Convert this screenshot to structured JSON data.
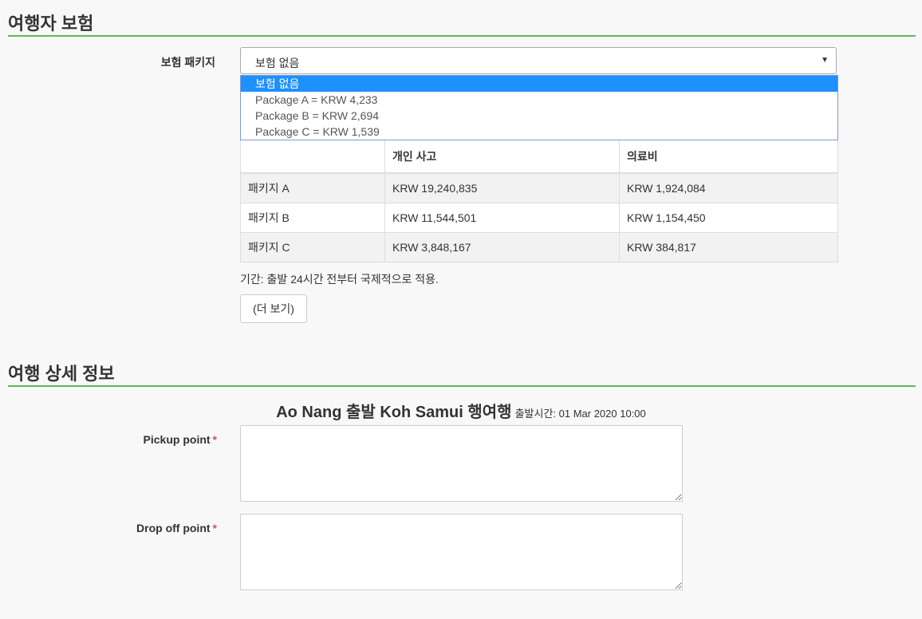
{
  "insurance": {
    "title": "여행자 보험",
    "package_label": "보험 패키지",
    "select": {
      "value": "보험 없음",
      "arrow": "▼",
      "options": [
        "보험 없음",
        "Package A = KRW 4,233",
        "Package B = KRW 2,694",
        "Package C = KRW 1,539"
      ]
    },
    "table": {
      "headers": [
        "",
        "개인 사고",
        "의료비"
      ],
      "rows": [
        [
          "패키지 A",
          "KRW 19,240,835",
          "KRW 1,924,084"
        ],
        [
          "패키지 B",
          "KRW 11,544,501",
          "KRW 1,154,450"
        ],
        [
          "패키지 C",
          "KRW 3,848,167",
          "KRW 384,817"
        ]
      ]
    },
    "period_text": "기간: 출발 24시간 전부터 국제적으로 적용.",
    "more_button": "(더 보기)"
  },
  "trip": {
    "title": "여행 상세 정보",
    "route": "Ao Nang 출발 Koh Samui 행여행",
    "departure": "출발시간: 01 Mar 2020 10:00",
    "pickup_label": "Pickup point",
    "dropoff_label": "Drop off point",
    "required_mark": "*",
    "pickup_value": "",
    "dropoff_value": ""
  },
  "colors": {
    "accent_rule": "#5cb85c",
    "dropdown_highlight": "#1e90ff",
    "required": "#d9534f"
  }
}
